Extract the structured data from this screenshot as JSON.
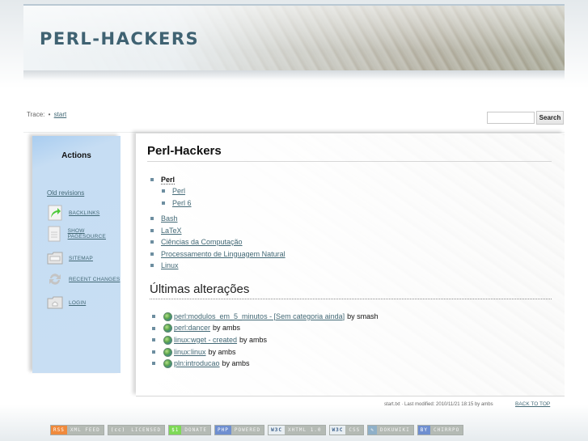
{
  "header": {
    "site_title": "PERL-HACKERS"
  },
  "trace": {
    "label": "Trace:",
    "separator": "•",
    "crumbs": [
      {
        "label": "start"
      }
    ]
  },
  "search": {
    "value": "",
    "placeholder": "",
    "button_label": "Search"
  },
  "sidebar": {
    "title": "Actions",
    "old_revisions": "Old revisions",
    "actions": [
      {
        "label": "Backlinks",
        "icon": "backlink-arrow-icon"
      },
      {
        "label": "Show pagesource",
        "icon": "document-icon"
      },
      {
        "label": "Sitemap",
        "icon": "folder-icon"
      },
      {
        "label": "Recent changes",
        "icon": "refresh-icon"
      },
      {
        "label": "Login",
        "icon": "folder-home-icon"
      }
    ]
  },
  "content": {
    "title": "Perl-Hackers",
    "nav": [
      {
        "label": "Perl",
        "current": true,
        "children": [
          {
            "label": "Perl"
          },
          {
            "label": "Perl 6"
          }
        ]
      },
      {
        "label": "Bash"
      },
      {
        "label": "LaTeX"
      },
      {
        "label": "Ciências da Computação"
      },
      {
        "label": "Processamento de Linguagem Natural"
      },
      {
        "label": "Linux"
      }
    ],
    "recent_heading": "Últimas alterações",
    "recent": [
      {
        "link": "perl:modulos_em_5_minutos - [Sem categoria ainda]",
        "by": "by smash"
      },
      {
        "link": "perl:dancer",
        "by": "by ambs"
      },
      {
        "link": "linux:wget - created",
        "by": "by ambs"
      },
      {
        "link": "linux:linux",
        "by": "by ambs"
      },
      {
        "link": "pln:introducao",
        "by": "by ambs"
      }
    ]
  },
  "page_meta": {
    "text": "start.txt · Last modified: 2010/11/21 18:15 by ambs",
    "back_to_top": "Back to top"
  },
  "footer": {
    "badges": [
      {
        "left": "RSS",
        "right": "XML FEED",
        "color": "#f08a3c"
      },
      {
        "left": "(cc)",
        "right": "LICENSED",
        "color": "#b4bab4"
      },
      {
        "left": "$1",
        "right": "DONATE",
        "color": "#7ed957"
      },
      {
        "left": "PHP",
        "right": "POWERED",
        "color": "#6f8fd0"
      },
      {
        "left": "W3C",
        "right": "XHTML 1.0",
        "color": "#e8eef2"
      },
      {
        "left": "W3C",
        "right": "CSS",
        "color": "#e8eef2"
      },
      {
        "left": "✎",
        "right": "DOKUWIKI",
        "color": "#8fb0c8"
      },
      {
        "left": "BY",
        "right": "CHIRRPO",
        "color": "#6f8fd0"
      }
    ]
  }
}
